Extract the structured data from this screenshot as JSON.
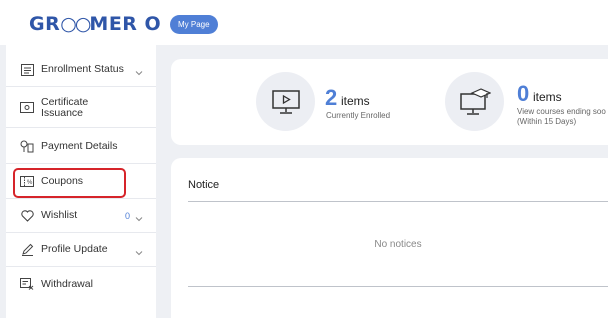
{
  "header": {
    "logo": "GROOMER O",
    "my_page_label": "My Page"
  },
  "sidebar": {
    "items": [
      {
        "label": "Enrollment Status",
        "icon": "list-icon",
        "has_chevron": true
      },
      {
        "label": "Certificate\nIssuance",
        "icon": "certificate-icon",
        "has_chevron": false
      },
      {
        "label": "Payment Details",
        "icon": "payment-icon",
        "has_chevron": false
      },
      {
        "label": "Coupons",
        "icon": "coupon-icon",
        "has_chevron": false
      },
      {
        "label": "Wishlist",
        "icon": "heart-icon",
        "count": "0",
        "has_chevron": true
      },
      {
        "label": "Profile Update",
        "icon": "pencil-icon",
        "has_chevron": true
      },
      {
        "label": "Withdrawal",
        "icon": "withdrawal-icon",
        "has_chevron": false
      }
    ],
    "highlight_color": "#d6242a"
  },
  "stats": {
    "enrolled": {
      "number": "2",
      "unit": "items",
      "sub": "Currently Enrolled"
    },
    "ending": {
      "number": "0",
      "unit": "items",
      "sub_line1": "View courses ending soo",
      "sub_line2": "(Within 15 Days)"
    }
  },
  "notice": {
    "title": "Notice",
    "empty_text": "No notices"
  },
  "colors": {
    "accent": "#4f7fd6",
    "brand": "#2f56a8",
    "background": "#eef0f4"
  }
}
